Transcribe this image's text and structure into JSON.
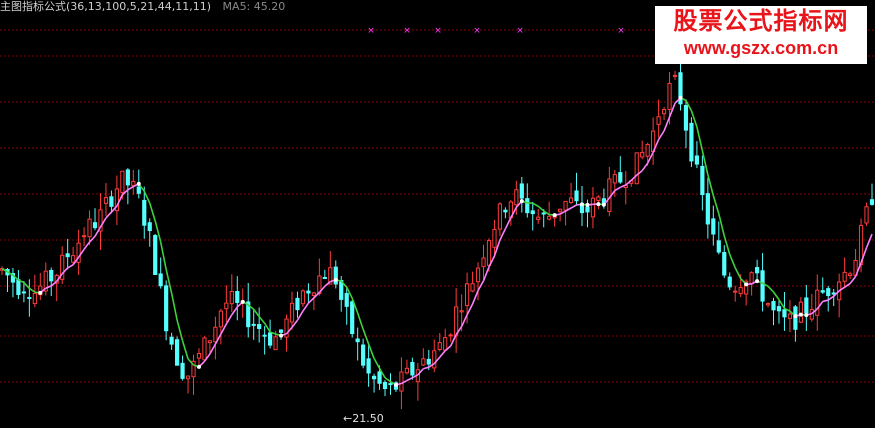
{
  "header": {
    "indicator_label": "主图指标公式(36,13,100,5,21,44,11,11)",
    "ma_label": "MA5: 45.20"
  },
  "watermark": {
    "line1": "股票公式指标网",
    "line2": "www.gszx.com.cn"
  },
  "marker_label": "←21.50",
  "colors": {
    "background": "#000000",
    "grid": "#8b0000",
    "up": "#ff3b3b",
    "down": "#54ffff",
    "ma_up": "#ff80ff",
    "ma_down": "#3cd23c",
    "signal": "#ff40ff"
  },
  "chart_data": {
    "type": "candlestick",
    "ma_series_name": "MA5",
    "ma_last": 45.2,
    "low_marker": 21.5,
    "price_path": [
      38,
      37,
      36,
      36,
      35,
      36,
      37,
      38,
      40,
      41,
      43,
      44,
      45,
      47,
      49,
      50,
      49,
      47,
      43,
      38,
      32,
      28,
      25,
      24,
      26,
      28,
      30,
      33,
      34,
      33,
      32,
      31,
      30,
      29,
      29,
      31,
      33,
      35,
      36,
      37,
      38,
      37,
      33,
      30,
      27,
      24,
      23,
      22,
      22,
      23,
      24,
      25,
      26,
      27,
      28,
      30,
      33,
      35,
      37,
      40,
      43,
      45,
      47,
      48,
      47,
      46,
      45,
      45,
      46,
      47,
      47,
      46,
      46,
      47,
      48,
      49,
      50,
      51,
      52,
      54,
      56,
      60,
      62,
      63,
      58,
      53,
      48,
      44,
      40,
      37,
      36,
      37,
      38,
      36,
      34,
      32,
      31,
      31,
      32,
      33,
      34,
      35,
      36,
      37,
      38,
      40,
      44,
      48
    ]
  }
}
